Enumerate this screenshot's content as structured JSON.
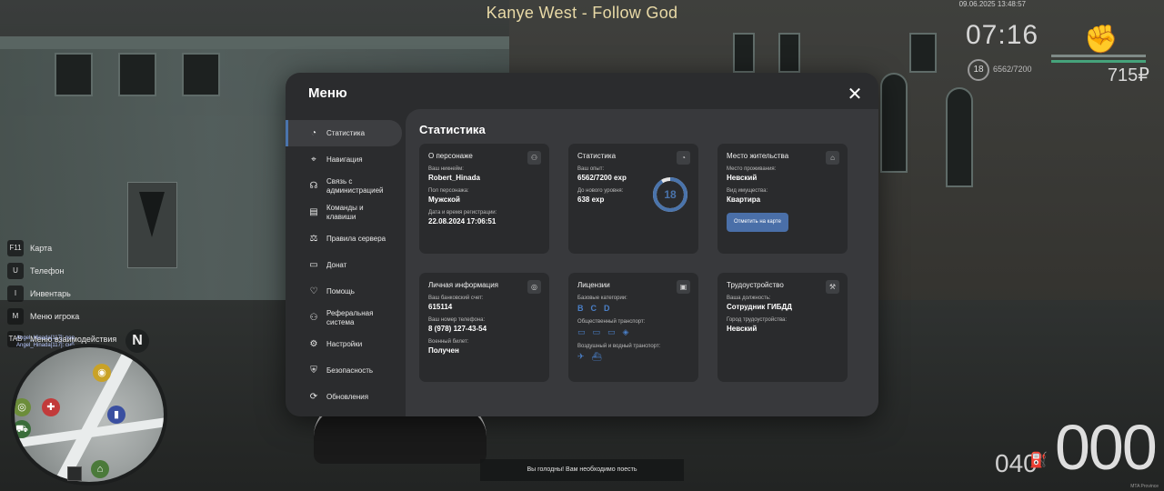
{
  "hud": {
    "song": "Kanye West - Follow God",
    "datetime": "09.06.2025 13:48:57",
    "time": "07:16",
    "level": "18",
    "exp": "6562/7200",
    "money": "715₽",
    "hunger_notice": "Вы голодны! Вам необходимо поесть",
    "speed": "000",
    "fuel": "040",
    "provider": "MTA Province"
  },
  "hotkeys": [
    {
      "key": "F11",
      "label": "Карта"
    },
    {
      "key": "U",
      "label": "Телефон"
    },
    {
      "key": "I",
      "label": "Инвентарь"
    },
    {
      "key": "M",
      "label": "Меню игрока"
    },
    {
      "key": "TAB",
      "label": "Меню взаимодействия"
    }
  ],
  "nicks": [
    "Angel_Hinada[117]: non",
    "Angel_Hinada[117]: cнб"
  ],
  "minimap": {
    "compass": "N"
  },
  "menu": {
    "title": "Меню",
    "close": "✕",
    "sidebar": [
      {
        "icon": "◔",
        "label": "Статистика",
        "active": true
      },
      {
        "icon": "⌖",
        "label": "Навигация"
      },
      {
        "icon": "☊",
        "label": "Связь с администрацией"
      },
      {
        "icon": "▤",
        "label": "Команды и клавиши"
      },
      {
        "icon": "⚖",
        "label": "Правила сервера"
      },
      {
        "icon": "▭",
        "label": "Донат"
      },
      {
        "icon": "♡",
        "label": "Помощь"
      },
      {
        "icon": "⚇",
        "label": "Реферальная система"
      },
      {
        "icon": "⚙",
        "label": "Настройки"
      },
      {
        "icon": "⛨",
        "label": "Безопасность"
      },
      {
        "icon": "⟳",
        "label": "Обновления"
      }
    ],
    "content_title": "Статистика",
    "cards": {
      "character": {
        "title": "О персонаже",
        "nick_label": "Ваш никнейм:",
        "nick": "Robert_Hinada",
        "gender_label": "Пол персонажа:",
        "gender": "Мужской",
        "reg_label": "Дата и время регистрации:",
        "reg": "22.08.2024 17:06:51"
      },
      "stats": {
        "title": "Статистика",
        "exp_label": "Ваш опыт:",
        "exp": "6562/7200 exp",
        "next_label": "До нового уровня:",
        "next": "638 exp",
        "level": "18",
        "progress": 0.911
      },
      "residence": {
        "title": "Место жительства",
        "place_label": "Место проживания:",
        "place": "Невский",
        "property_label": "Вид имущества:",
        "property": "Квартира",
        "button": "Отметить на карте"
      },
      "personal": {
        "title": "Личная информация",
        "bank_label": "Ваш банковский счет:",
        "bank": "615114",
        "phone_label": "Ваш номер телефона:",
        "phone": "8 (978) 127-43-54",
        "military_label": "Военный билет:",
        "military": "Получен"
      },
      "licenses": {
        "title": "Лицензии",
        "basic_label": "Базовые категории:",
        "basic": [
          "B",
          "C",
          "D"
        ],
        "public_label": "Общественный транспорт:",
        "air_label": "Воздушный и водный транспорт:"
      },
      "job": {
        "title": "Трудоустройство",
        "position_label": "Ваша должность:",
        "position": "Сотрудник ГИБДД",
        "city_label": "Город трудоустройства:",
        "city": "Невский"
      }
    }
  },
  "colors": {
    "accent": "#4a74ac",
    "card": "#2a2b2d",
    "panel": "#38393c"
  }
}
